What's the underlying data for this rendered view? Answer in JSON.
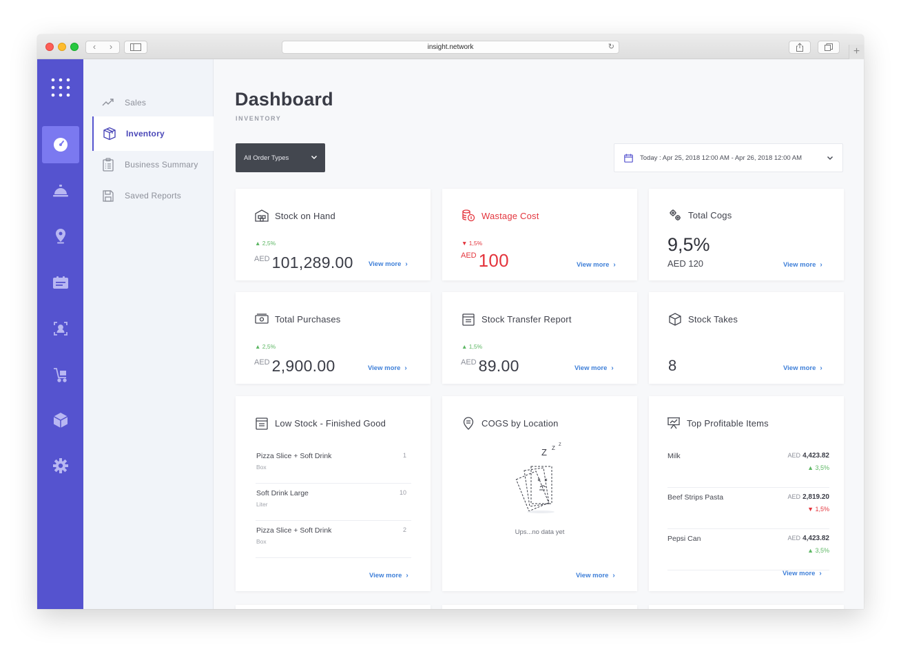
{
  "browser": {
    "url": "insight.network",
    "back": "‹",
    "forward": "›",
    "plus": "+"
  },
  "subnav": [
    {
      "label": "Sales",
      "icon": "trend-line-icon"
    },
    {
      "label": "Inventory",
      "icon": "box-icon"
    },
    {
      "label": "Business Summary",
      "icon": "clipboard-icon"
    },
    {
      "label": "Saved Reports",
      "icon": "save-icon"
    }
  ],
  "rail": [
    "apps-grid-icon",
    "dashboard-gauge-icon",
    "cloche-icon",
    "location-pin-icon",
    "list-card-icon",
    "user-badge-icon",
    "cart-icon",
    "cube-icon",
    "gear-icon"
  ],
  "header": {
    "title": "Dashboard",
    "subtitle": "INVENTORY"
  },
  "filters": {
    "order_type": "All Order Types",
    "date_range": "Today : Apr 25, 2018 12:00 AM - Apr 26, 2018 12:00 AM"
  },
  "view_more": "View more",
  "cards": {
    "stock_on_hand": {
      "title": "Stock on Hand",
      "trend": "▲ 2,5%",
      "currency": "AED",
      "value": "101,289.00"
    },
    "wastage_cost": {
      "title": "Wastage Cost",
      "trend": "▼ 1,5%",
      "currency": "AED",
      "value": "100"
    },
    "total_cogs": {
      "title": "Total Cogs",
      "value": "9,5%",
      "sub": "AED 120"
    },
    "total_purchases": {
      "title": "Total Purchases",
      "trend": "▲ 2,5%",
      "currency": "AED",
      "value": "2,900.00"
    },
    "stock_transfer": {
      "title": "Stock Transfer Report",
      "trend": "▲ 1,5%",
      "currency": "AED",
      "value": "89.00"
    },
    "stock_takes": {
      "title": "Stock Takes",
      "value": "8"
    },
    "low_stock": {
      "title": "Low Stock - Finished Good",
      "items": [
        {
          "name": "Pizza Slice + Soft Drink",
          "unit": "Box",
          "qty": "1"
        },
        {
          "name": "Soft Drink Large",
          "unit": "Liter",
          "qty": "10"
        },
        {
          "name": "Pizza Slice + Soft Drink",
          "unit": "Box",
          "qty": "2"
        }
      ]
    },
    "cogs_location": {
      "title": "COGS by Location",
      "empty": "Ups...no data yet",
      "zzz": "Z"
    },
    "top_profitable": {
      "title": "Top Profitable Items",
      "items": [
        {
          "name": "Milk",
          "currency": "AED",
          "value": "4,423.82",
          "trend": "▲ 3,5%",
          "dir": "up"
        },
        {
          "name": "Beef Strips Pasta",
          "currency": "AED",
          "value": "2,819.20",
          "trend": "▼ 1,5%",
          "dir": "down"
        },
        {
          "name": "Pepsi Can",
          "currency": "AED",
          "value": "4,423.82",
          "trend": "▲ 3,5%",
          "dir": "up"
        }
      ]
    }
  },
  "colors": {
    "rail": "#5553cf",
    "rail_active": "#7b79f0",
    "accent_link": "#3e7fd8",
    "negative": "#e3343c",
    "positive": "#5db764"
  }
}
